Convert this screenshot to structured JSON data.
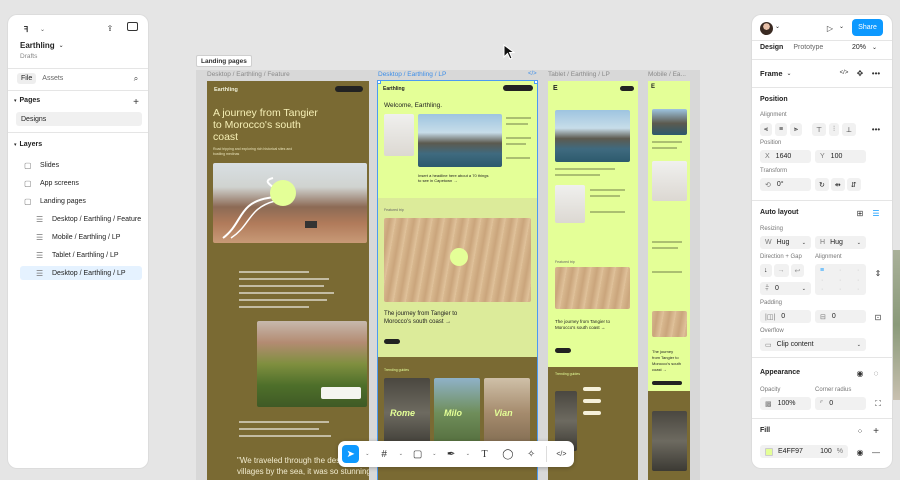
{
  "left_panel": {
    "file_name": "Earthling",
    "file_location": "Drafts",
    "tabs": {
      "file": "File",
      "assets": "Assets"
    },
    "pages_label": "Pages",
    "pages": [
      "Designs"
    ],
    "layers_label": "Layers",
    "layers": [
      "Slides",
      "App screens",
      "Landing pages",
      "Desktop / Earthling / Feature",
      "Mobile / Earthling / LP",
      "Tablet / Earthling / LP",
      "Desktop / Earthling / LP"
    ]
  },
  "canvas": {
    "section_label": "Landing pages",
    "frames": {
      "feature": "Desktop / Earthling / Feature",
      "desktop_lp": "Desktop / Earthling / LP",
      "tablet_lp": "Tablet / Earthling / LP",
      "mobile_lp": "Mobile / Ea..."
    },
    "feature_frame": {
      "brand": "Earthling",
      "headline_1": "A journey from Tangier",
      "headline_2": "to Morocco's south",
      "headline_3": "coast",
      "sub_1": "Road tripping and exploring rich historical sites and",
      "sub_2": "bustling medinas",
      "quote_1": "\"We traveled through the desert to small",
      "quote_2": "villages by the sea, it was so stunning—"
    },
    "lp_frame": {
      "brand": "Earthling",
      "welcome": "Welcome, Earthling.",
      "insert_1": "Insert a headline here about a 70 things",
      "insert_2": "to see in Capetown →",
      "featured_trip": "Featured trip",
      "journey_1": "The journey from Tangier to",
      "journey_2": "Morocco's south coast →",
      "trending": "Trending guides",
      "guide_1": "Rome",
      "guide_2": "Milo",
      "guide_3": "Vian"
    },
    "tablet_frame": {
      "featured_trip": "Featured trip",
      "journey_1": "The journey from Tangier to",
      "journey_2": "Morocco's south coast →",
      "trending": "Trending guides"
    },
    "mobile_frame": {
      "journey_1": "The journey",
      "journey_2": "from Tangier to",
      "journey_3": "Morocco's south",
      "journey_4": "coast →"
    }
  },
  "toolbar": {
    "code_label": "</>"
  },
  "right_panel": {
    "share": "Share",
    "tabs": {
      "design": "Design",
      "prototype": "Prototype"
    },
    "zoom": "20%",
    "frame_label": "Frame",
    "position_title": "Position",
    "alignment_label": "Alignment",
    "position_label": "Position",
    "x_label": "X",
    "x_value": "1640",
    "y_label": "Y",
    "y_value": "100",
    "transform_label": "Transform",
    "rotation_value": "0°",
    "auto_layout_title": "Auto layout",
    "resizing_label": "Resizing",
    "w_label": "W",
    "w_value": "Hug",
    "h_label": "H",
    "h_value": "Hug",
    "direction_gap_label": "Direction + Gap",
    "alignment2_label": "Alignment",
    "gap_value": "0",
    "padding_label": "Padding",
    "padding_h": "0",
    "padding_v": "0",
    "overflow_label": "Overflow",
    "overflow_value": "Clip content",
    "appearance_title": "Appearance",
    "opacity_label": "Opacity",
    "opacity_value": "100%",
    "corner_label": "Corner radius",
    "corner_value": "0",
    "fill_title": "Fill",
    "fill_hex": "E4FF97",
    "fill_opacity": "100",
    "fill_percent": "%"
  },
  "colors": {
    "accent": "#0d99ff",
    "olive": "#7a6a33",
    "lime": "#e4ff97",
    "selection": "#4c9bf2"
  }
}
